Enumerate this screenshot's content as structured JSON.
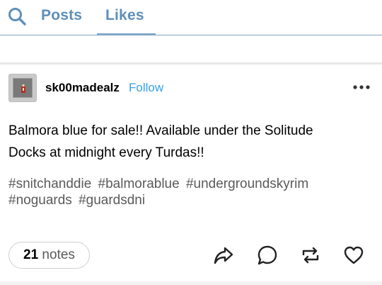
{
  "tabs": {
    "search_icon": "search-icon",
    "items": [
      {
        "label": "Posts",
        "active": false
      },
      {
        "label": "Likes",
        "active": true
      }
    ],
    "accent_color": "#5d8fba"
  },
  "post": {
    "avatar_icon": "avatar",
    "username": "sk00madealz",
    "follow_label": "Follow",
    "follow_color": "#33a1e4",
    "more_icon": "more-options-icon",
    "body_lines": [
      "Balmora blue for sale!! Available under the Solitude",
      "Docks at midnight every Turdas!!"
    ],
    "tags": [
      "#snitchanddie",
      "#balmorablue",
      "#undergroundskyrim",
      "#noguards",
      "#guardsdni"
    ],
    "notes_count": "21",
    "notes_label": "notes",
    "actions": [
      "share-icon",
      "reply-icon",
      "reblog-icon",
      "like-icon"
    ]
  }
}
